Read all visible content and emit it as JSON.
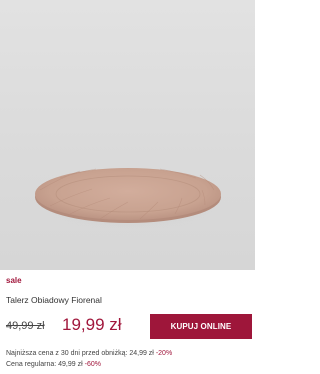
{
  "product": {
    "image_alt": "plate",
    "badge": "sale",
    "name": "Talerz Obiadowy Fiorenal",
    "old_price": "49,99 zł",
    "new_price": "19,99 zł",
    "buy_label": "KUPUJ ONLINE",
    "lowest_price_text": "Najniższa cena z 30 dni przed obniżką: 24,99 zł",
    "lowest_price_pct": "-20%",
    "regular_price_text": "Cena regularna: 49,99 zł",
    "regular_price_pct": "-60%"
  },
  "colors": {
    "accent": "#9e163a",
    "plate": "#c9a393"
  }
}
